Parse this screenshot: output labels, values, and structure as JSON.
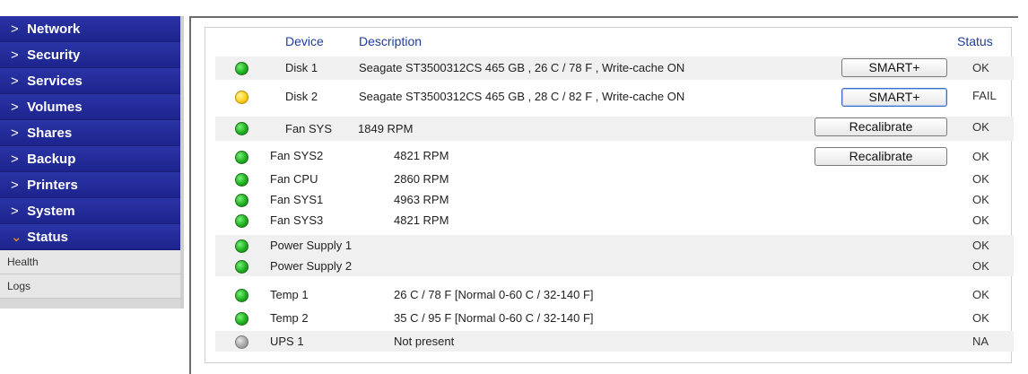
{
  "sidebar": {
    "nav": [
      {
        "label": "Network",
        "active": false
      },
      {
        "label": "Security",
        "active": false
      },
      {
        "label": "Services",
        "active": false
      },
      {
        "label": "Volumes",
        "active": false
      },
      {
        "label": "Shares",
        "active": false
      },
      {
        "label": "Backup",
        "active": false
      },
      {
        "label": "Printers",
        "active": false
      },
      {
        "label": "System",
        "active": false
      },
      {
        "label": "Status",
        "active": true
      }
    ],
    "sub_items": [
      {
        "label": "Health"
      },
      {
        "label": "Logs"
      }
    ]
  },
  "table": {
    "headers": {
      "device": "Device",
      "description": "Description",
      "status": "Status"
    },
    "rows": [
      {
        "led": "green",
        "device": "Disk 1",
        "description": "Seagate ST3500312CS 465 GB , 26 C / 78 F , Write-cache ON",
        "action": "SMART+",
        "status": "OK"
      },
      {
        "led": "yellow",
        "device": "Disk 2",
        "description": "Seagate ST3500312CS 465 GB , 28 C / 82 F , Write-cache ON",
        "action": "SMART+",
        "status": "FAIL"
      },
      {
        "led": "green",
        "device": "Fan SYS",
        "description": "1849 RPM",
        "action": "Recalibrate",
        "status": "OK"
      },
      {
        "led": "green",
        "device": "Fan SYS2",
        "description": "4821 RPM",
        "action": "Recalibrate",
        "status": "OK"
      },
      {
        "led": "green",
        "device": "Fan CPU",
        "description": "2860 RPM",
        "action": "",
        "status": "OK"
      },
      {
        "led": "green",
        "device": "Fan SYS1",
        "description": "4963 RPM",
        "action": "",
        "status": "OK"
      },
      {
        "led": "green",
        "device": "Fan SYS3",
        "description": "4821 RPM",
        "action": "",
        "status": "OK"
      },
      {
        "led": "green",
        "device": "Power Supply 1",
        "description": "",
        "action": "",
        "status": "OK"
      },
      {
        "led": "green",
        "device": "Power Supply 2",
        "description": "",
        "action": "",
        "status": "OK"
      },
      {
        "led": "green",
        "device": "Temp 1",
        "description": "26 C / 78 F [Normal 0-60 C / 32-140 F]",
        "action": "",
        "status": "OK"
      },
      {
        "led": "green",
        "device": "Temp 2",
        "description": "35 C / 95 F [Normal 0-60 C / 32-140 F]",
        "action": "",
        "status": "OK"
      },
      {
        "led": "gray",
        "device": "UPS 1",
        "description": "Not present",
        "action": "",
        "status": "NA"
      }
    ]
  },
  "colors": {
    "nav_bg": "#1d248d",
    "active_chevron": "#ff9a1a",
    "header_text": "#1f3d9b",
    "led_ok": "#1fb11f",
    "led_fail": "#ffd21a",
    "led_na": "#a8a8a8"
  },
  "icons": {
    "nav_chevron": "chevron-right-icon",
    "active_chevron": "chevron-down-icon",
    "status_led": "status-led-icon"
  }
}
